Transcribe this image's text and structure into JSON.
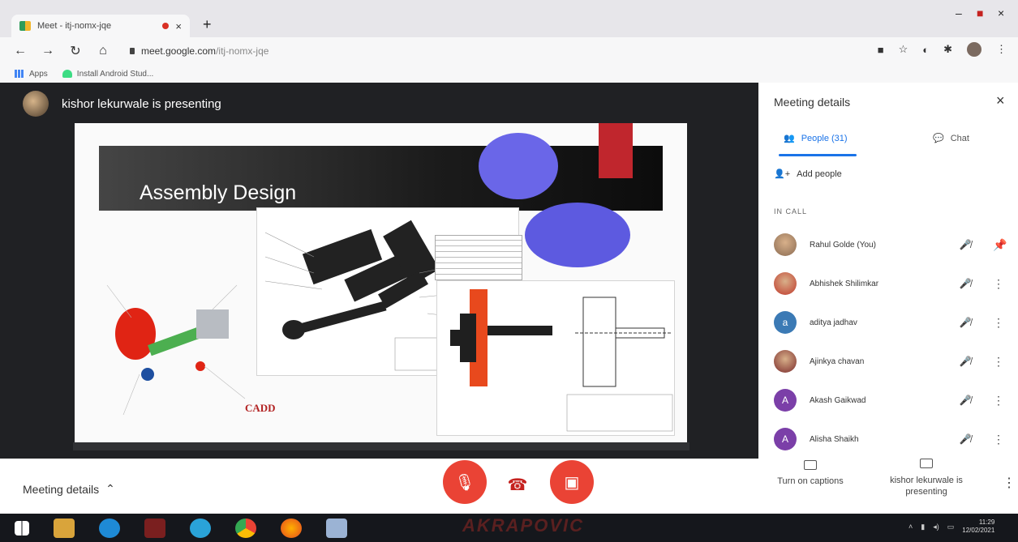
{
  "browser": {
    "tab_title": "Meet - itj-nomx-jqe",
    "tab_close": "×",
    "new_tab": "+",
    "url_domain": "meet.google.com",
    "url_path": "/itj-nomx-jqe",
    "bookmarks": [
      {
        "label": "Apps",
        "icon": "apps-grid-icon"
      },
      {
        "label": "Install Android Stud...",
        "icon": "android-icon"
      }
    ],
    "window_controls": [
      "-",
      "■"
    ]
  },
  "stage": {
    "presenter_text": "kishor lekurwale is presenting",
    "slide_title": "Assembly Design",
    "slide_logo": "CADD"
  },
  "panel": {
    "title": "Meeting details",
    "close": "×",
    "tab_people": "People (31)",
    "tab_chat": "Chat",
    "add_people": "Add people",
    "section_label": "IN CALL",
    "participants": [
      {
        "name": "Rahul Golde (You)",
        "initial": "",
        "avatar_color": "#8a6b52",
        "photo": true,
        "action": "pin-icon"
      },
      {
        "name": "Abhishek Shilimkar",
        "initial": "",
        "avatar_color": "#c0392b",
        "photo": true,
        "action": "more-icon"
      },
      {
        "name": "aditya jadhav",
        "initial": "a",
        "avatar_color": "#3b7ab5",
        "photo": false,
        "action": "more-icon"
      },
      {
        "name": "Ajinkya chavan",
        "initial": "",
        "avatar_color": "#7a2a2a",
        "photo": true,
        "action": "more-icon"
      },
      {
        "name": "Akash Gaikwad",
        "initial": "A",
        "avatar_color": "#7b3fa8",
        "photo": false,
        "action": "more-icon"
      },
      {
        "name": "Alisha Shaikh",
        "initial": "A",
        "avatar_color": "#7b3fa8",
        "photo": false,
        "action": "more-icon"
      }
    ]
  },
  "bottom": {
    "meeting_details": "Meeting details",
    "captions": "Turn on captions",
    "presenting": "kishor lekurwale is presenting"
  },
  "taskbar": {
    "wallpaper_text": "AKRAPOVIC",
    "clock_time": "11:29",
    "clock_date": "12/02/2021"
  },
  "colors": {
    "accent": "#1a73e8",
    "danger": "#ea4335",
    "stage_bg": "#202124"
  }
}
